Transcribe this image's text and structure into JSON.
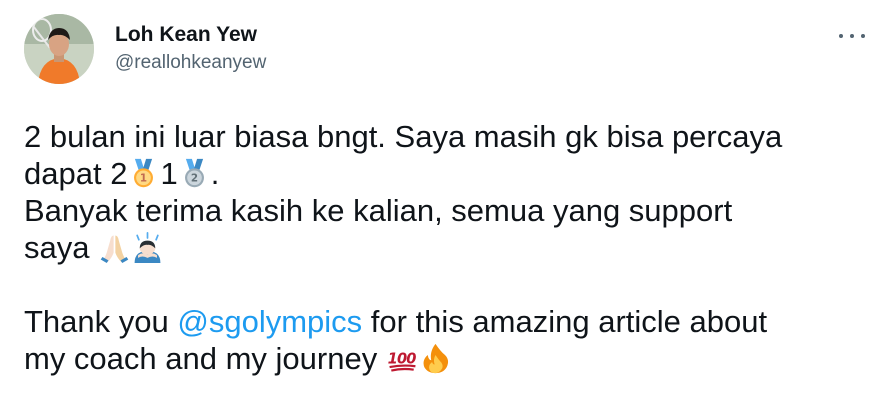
{
  "author": {
    "display_name": "Loh Kean Yew",
    "handle": "@reallohkeanyew"
  },
  "tweet": {
    "line1": "2 bulan ini luar biasa bngt. Saya masih gk bisa percaya",
    "line2_a": "dapat 2",
    "line2_b": "1",
    "line2_c": ".",
    "line3": "Banyak terima kasih ke kalian, semua yang support",
    "line4": "saya",
    "line5_a": "Thank you ",
    "mention": "@sgolympics",
    "line5_b": " for this amazing article about",
    "line6": "my coach and my journey",
    "emoji_medal_1": "1",
    "emoji_medal_2": "2",
    "emoji_100": "100"
  },
  "icons": {
    "more": "more-horizontal-icon",
    "gold_medal": "gold-medal-emoji",
    "silver_medal": "silver-medal-emoji",
    "folded_hands": "folded-hands-emoji",
    "bowing_person": "bowing-person-emoji",
    "hundred": "hundred-points-emoji",
    "fire": "fire-emoji"
  },
  "colors": {
    "text": "#0f1419",
    "secondary": "#536471",
    "link": "#1d9bf0"
  }
}
